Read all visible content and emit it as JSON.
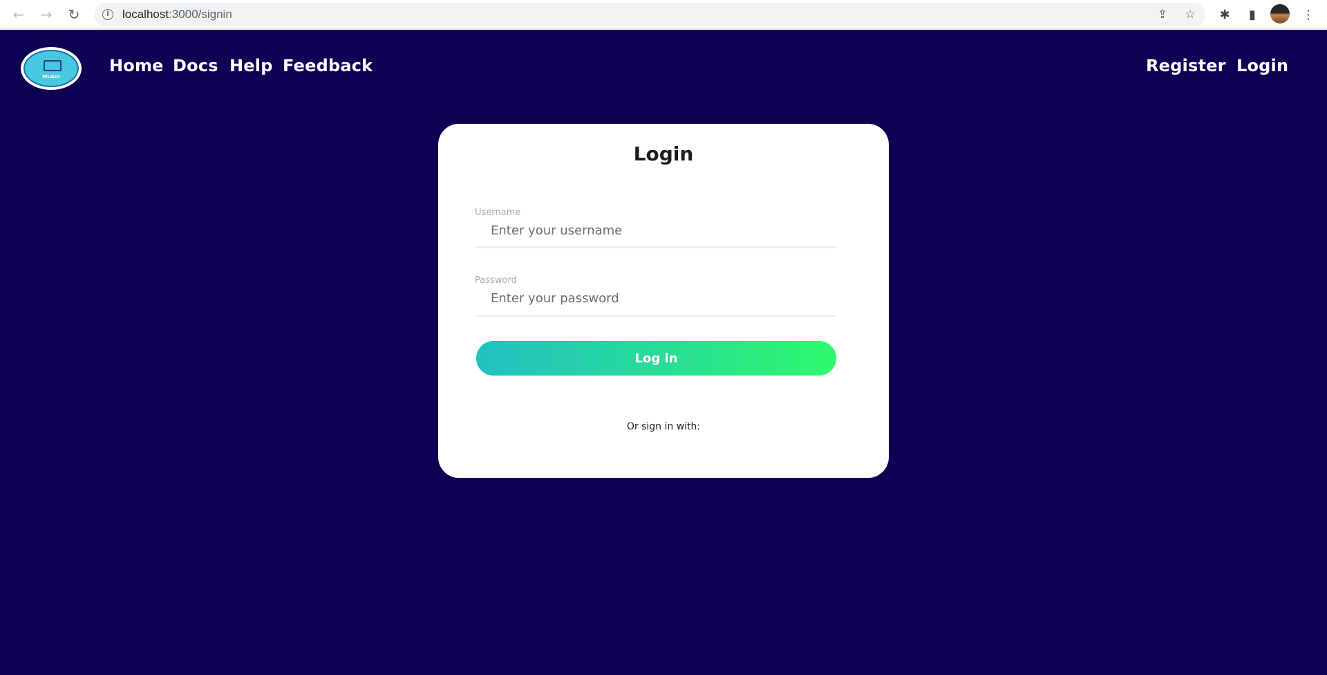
{
  "browser": {
    "url_host": "localhost",
    "url_path": ":3000/signin",
    "back_icon": "←",
    "forward_icon": "→",
    "reload_icon": "↻",
    "info_icon": "i",
    "share_icon": "⇪",
    "bookmark_icon": "☆",
    "extensions_icon": "✱",
    "sidepanel_icon": "▮",
    "menu_icon": "⋮"
  },
  "navbar": {
    "logo_text": "MLGUI",
    "links": [
      "Home",
      "Docs",
      "Help",
      "Feedback"
    ],
    "right_links": [
      "Register",
      "Login"
    ]
  },
  "login_card": {
    "title": "Login",
    "username_label": "Username",
    "username_placeholder": "Enter your username",
    "password_label": "Password",
    "password_placeholder": "Enter your password",
    "submit_label": "Log in",
    "alt_signin_text": "Or sign in with:"
  },
  "colors": {
    "page_background": "#0e0153",
    "button_gradient_start": "#21c0c3",
    "button_gradient_end": "#2ff86c"
  }
}
